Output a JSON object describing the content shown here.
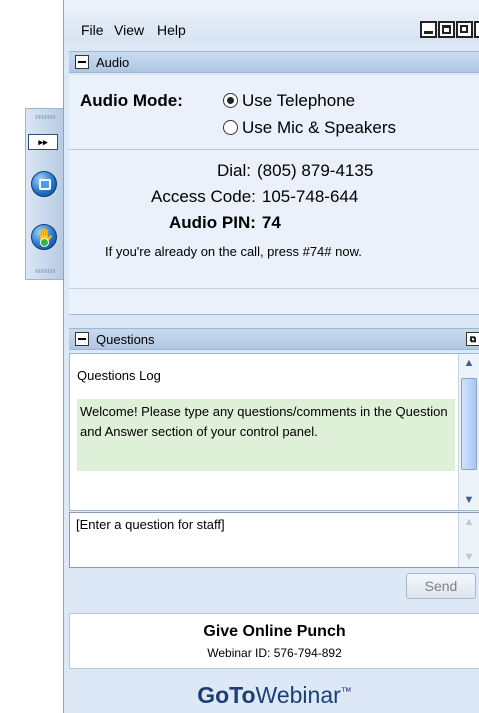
{
  "menu": {
    "file": "File",
    "view": "View",
    "help": "Help"
  },
  "toolbar": {
    "expand_label": "▸▸"
  },
  "audio": {
    "section_title": "Audio",
    "mode_label": "Audio Mode:",
    "options": [
      "Use Telephone",
      "Use Mic & Speakers"
    ],
    "selected_option": "Use Telephone",
    "dial_label": "Dial:",
    "dial_value": "(805) 879-4135",
    "access_label": "Access Code:",
    "access_value": "105-748-644",
    "pin_label": "Audio PIN:",
    "pin_value": "74",
    "hint": "If you're already on the call, press #74# now."
  },
  "questions": {
    "section_title": "Questions",
    "log_title": "Questions Log",
    "welcome": "Welcome! Please type any questions/comments in the Question and Answer section of your control panel.",
    "input_placeholder": "[Enter a question for staff]",
    "send_label": "Send"
  },
  "webinar": {
    "title": "Give Online Punch",
    "id_text": "Webinar ID: 576-794-892"
  },
  "brand": {
    "goto": "GoTo",
    "webinar": "Webinar",
    "tm": "™"
  },
  "colors": {
    "panel_bg": "#dce8f5",
    "header_bg": "#afc7e3",
    "welcome_bg": "#dff0d8",
    "brand": "#1d3f73"
  }
}
